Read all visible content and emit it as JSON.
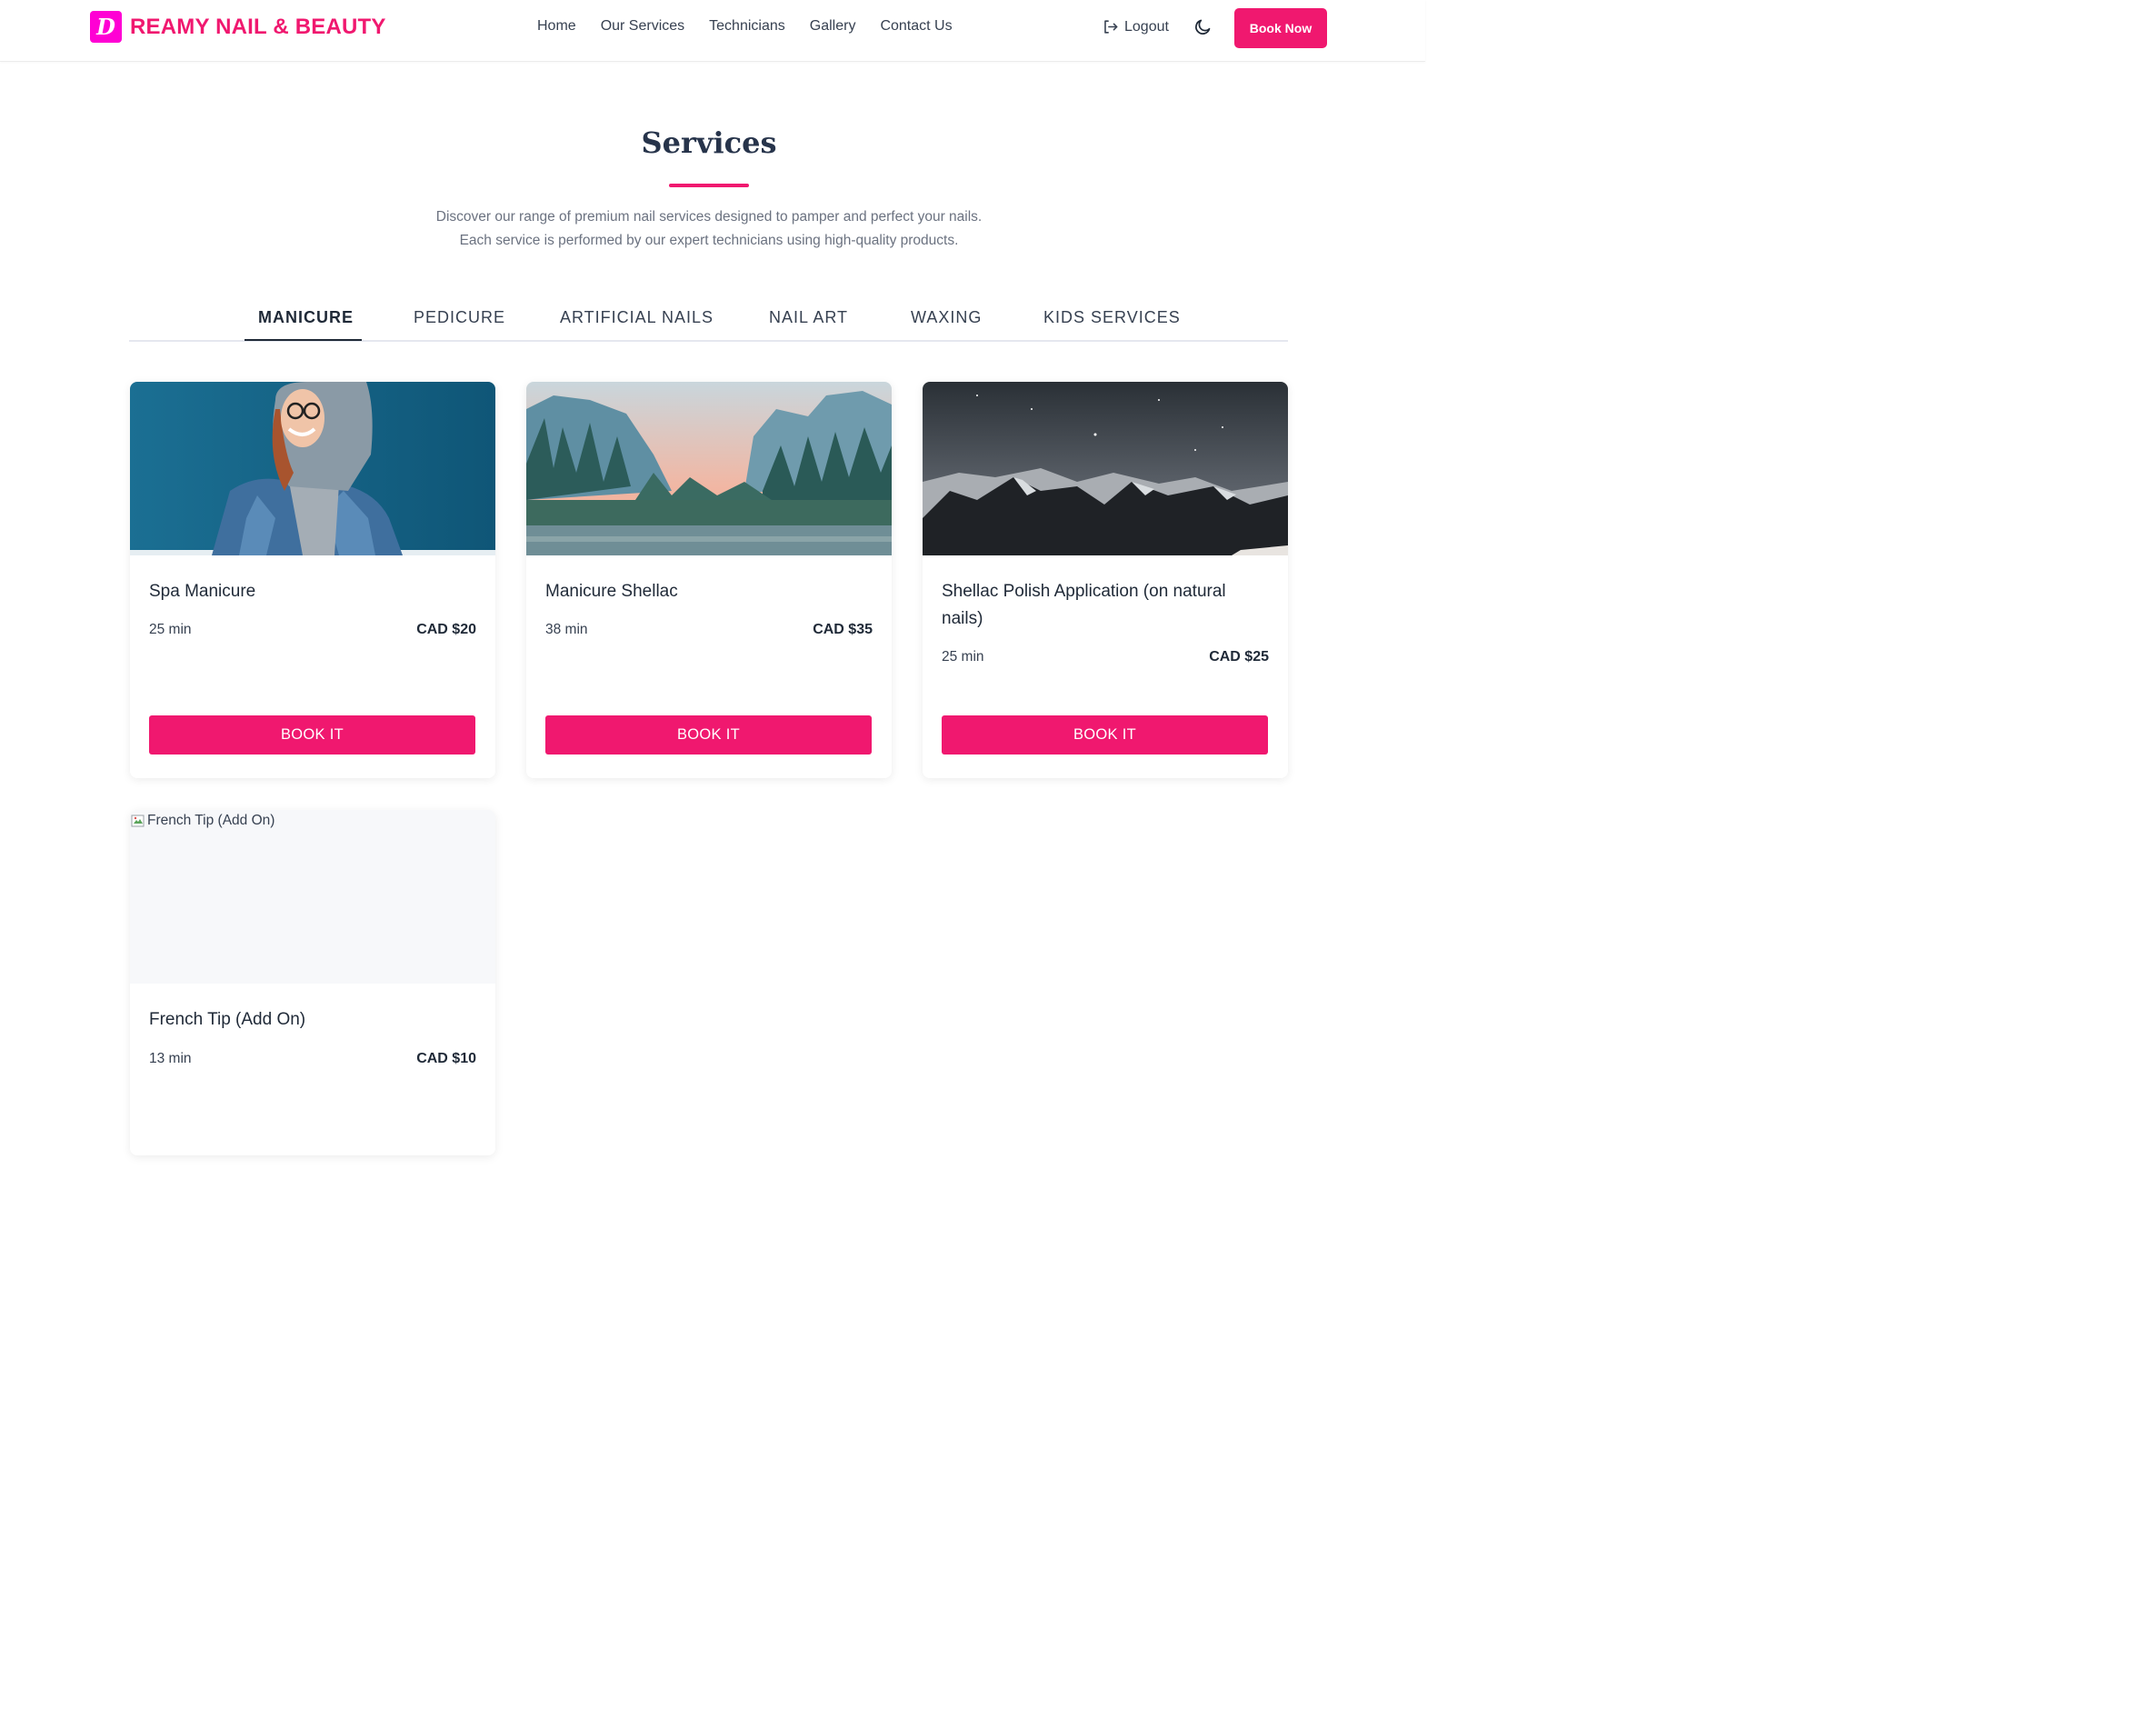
{
  "header": {
    "logo_letter": "D",
    "brand": "REAMY NAIL & BEAUTY",
    "nav": [
      "Home",
      "Our Services",
      "Technicians",
      "Gallery",
      "Contact Us"
    ],
    "logout": "Logout",
    "book_now": "Book Now"
  },
  "section": {
    "title": "Services",
    "intro_line1": "Discover our range of premium nail services designed to pamper and perfect your nails.",
    "intro_line2": "Each service is performed by our expert technicians using high-quality products."
  },
  "tabs": [
    "MANICURE",
    "PEDICURE",
    "ARTIFICIAL NAILS",
    "NAIL ART",
    "WAXING",
    "KIDS SERVICES"
  ],
  "active_tab": "MANICURE",
  "services": [
    {
      "name": "Spa Manicure",
      "duration": "25 min",
      "price": "CAD $20",
      "button": "BOOK IT",
      "image": "woman-denim-hoodie-photo"
    },
    {
      "name": "Manicure Shellac",
      "duration": "38 min",
      "price": "CAD $35",
      "button": "BOOK IT",
      "image": "forest-valley-photo"
    },
    {
      "name": "Shellac Polish Application (on natural nails)",
      "duration": "25 min",
      "price": "CAD $25",
      "button": "BOOK IT",
      "image": "mountain-night-photo"
    },
    {
      "name": "French Tip (Add On)",
      "duration": "13 min",
      "price": "CAD $10",
      "image_alt": "French Tip (Add On)"
    }
  ],
  "colors": {
    "accent": "#f0186f",
    "logo_badge": "#ff00d4",
    "heading": "#27344b"
  }
}
